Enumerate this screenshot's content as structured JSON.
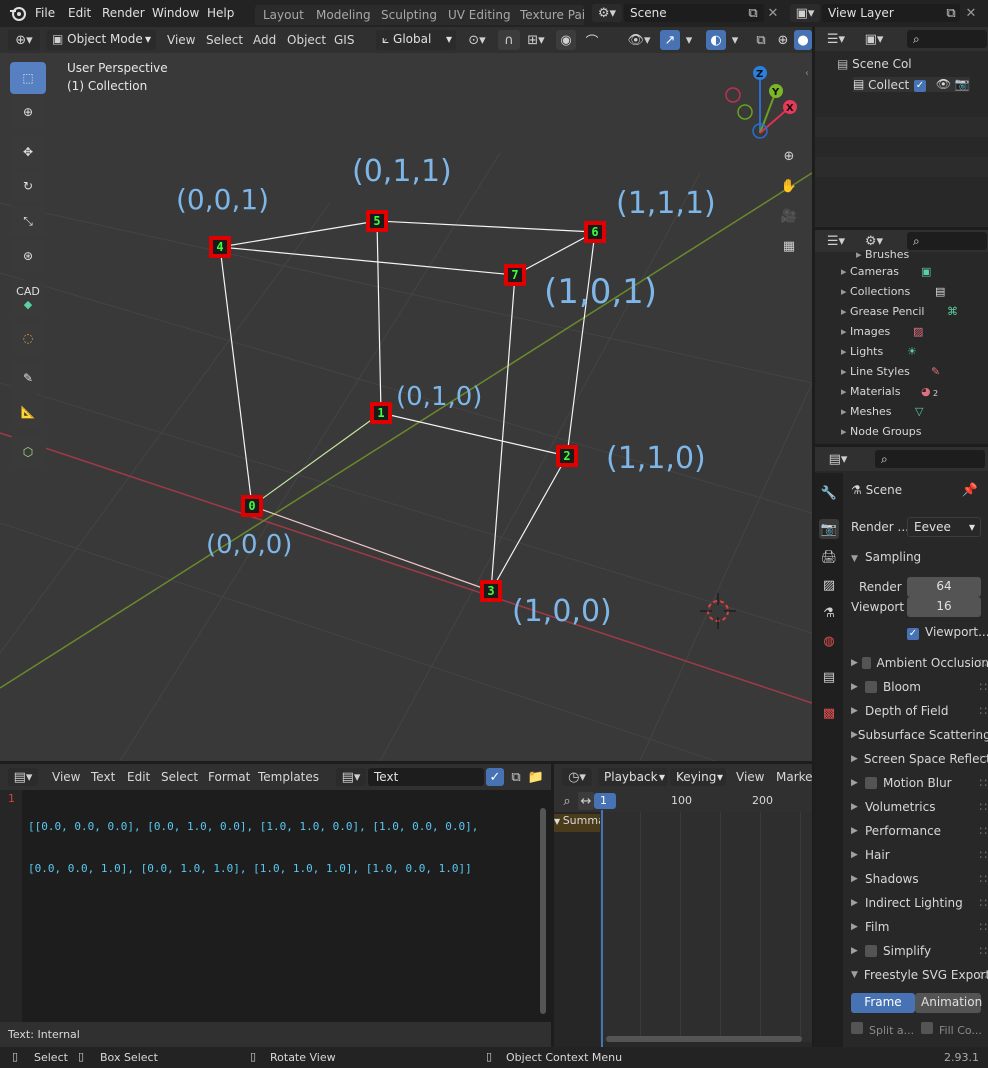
{
  "topbar": {
    "menus": [
      "File",
      "Edit",
      "Render",
      "Window",
      "Help"
    ],
    "workspaces": [
      "Layout",
      "Modeling",
      "Sculpting",
      "UV Editing",
      "Texture Paint"
    ],
    "scene": "Scene",
    "view_layer": "View Layer"
  },
  "viewport_header": {
    "mode": "Object Mode",
    "menus": [
      "View",
      "Select",
      "Add",
      "Object",
      "GIS"
    ],
    "transform_orientation": "Global"
  },
  "viewport": {
    "perspective_label": "User Perspective",
    "collection_label": "(1) Collection",
    "cad_label": "CAD",
    "vertices": [
      "0",
      "1",
      "2",
      "3",
      "4",
      "5",
      "6",
      "7"
    ],
    "annotations": [
      "(0,0,0)",
      "(0,1,0)",
      "(1,1,0)",
      "(1,0,0)",
      "(0,0,1)",
      "(0,1,1)",
      "(1,1,1)",
      "(1,0,1)"
    ],
    "gizmo": {
      "z": "Z",
      "y": "Y",
      "x": "X"
    }
  },
  "outliner": {
    "scene_collection": "Scene Collection",
    "collection": "Collection"
  },
  "data_browser": {
    "items": [
      "Brushes",
      "Cameras",
      "Collections",
      "Grease Pencil",
      "Images",
      "Lights",
      "Line Styles",
      "Materials",
      "Meshes",
      "Node Groups"
    ],
    "materials_badge": "2"
  },
  "properties": {
    "scene_label": "Scene",
    "render_engine_label": "Render ...",
    "render_engine": "Eevee",
    "sampling_label": "Sampling",
    "render_label": "Render",
    "render_value": "64",
    "viewport_label": "Viewport",
    "viewport_value": "16",
    "viewport_denoise": "Viewport...",
    "panels": [
      {
        "label": "Ambient Occlusion",
        "checkbox": true
      },
      {
        "label": "Bloom",
        "checkbox": true
      },
      {
        "label": "Depth of Field",
        "checkbox": false
      },
      {
        "label": "Subsurface Scattering",
        "checkbox": false
      },
      {
        "label": "Screen Space Reflections",
        "checkbox": true
      },
      {
        "label": "Motion Blur",
        "checkbox": true
      },
      {
        "label": "Volumetrics",
        "checkbox": false
      },
      {
        "label": "Performance",
        "checkbox": false
      },
      {
        "label": "Hair",
        "checkbox": false
      },
      {
        "label": "Shadows",
        "checkbox": false
      },
      {
        "label": "Indirect Lighting",
        "checkbox": false
      },
      {
        "label": "Film",
        "checkbox": false
      },
      {
        "label": "Simplify",
        "checkbox": true
      },
      {
        "label": "Freestyle SVG Export",
        "checkbox": true
      }
    ],
    "frame_tab": "Frame",
    "animation_tab": "Animation",
    "split_label": "Split a...",
    "fill_label": "Fill Co..."
  },
  "text_editor": {
    "menus": [
      "View",
      "Text",
      "Edit",
      "Select",
      "Format",
      "Templates"
    ],
    "text_name": "Text",
    "line_number": "1",
    "line1": "[[0.0, 0.0, 0.0], [0.0, 1.0, 0.0], [1.0, 1.0, 0.0], [1.0, 0.0, 0.0],",
    "line2": "[0.0, 0.0, 1.0], [0.0, 1.0, 1.0], [1.0, 1.0, 1.0], [1.0, 0.0, 1.0]]",
    "footer": "Text: Internal"
  },
  "timeline": {
    "menus": [
      "Playback",
      "Keying",
      "View",
      "Marker"
    ],
    "current_frame": "1",
    "ticks": [
      "100",
      "200"
    ],
    "summary": "Summary"
  },
  "statusbar": {
    "select": "Select",
    "box_select": "Box Select",
    "rotate_view": "Rotate View",
    "context_menu": "Object Context Menu",
    "version": "2.93.1"
  }
}
